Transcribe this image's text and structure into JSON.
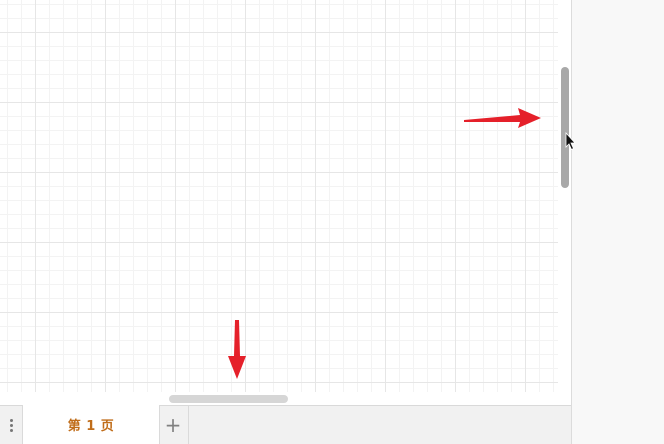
{
  "page_tabs": {
    "menu_icon": "more-vertical-icon",
    "tabs": [
      {
        "label": "第 1 页",
        "active": true
      }
    ],
    "add_icon_glyph": "+",
    "active_tab_color": "#c06d1a"
  },
  "canvas": {
    "grid": true,
    "grid_color": "#e6e6e6"
  },
  "annotations": {
    "arrow_color": "#e5202a",
    "arrows": [
      "right-pointing-arrow",
      "down-pointing-arrow"
    ]
  },
  "cursor": "mouse-pointer-icon"
}
